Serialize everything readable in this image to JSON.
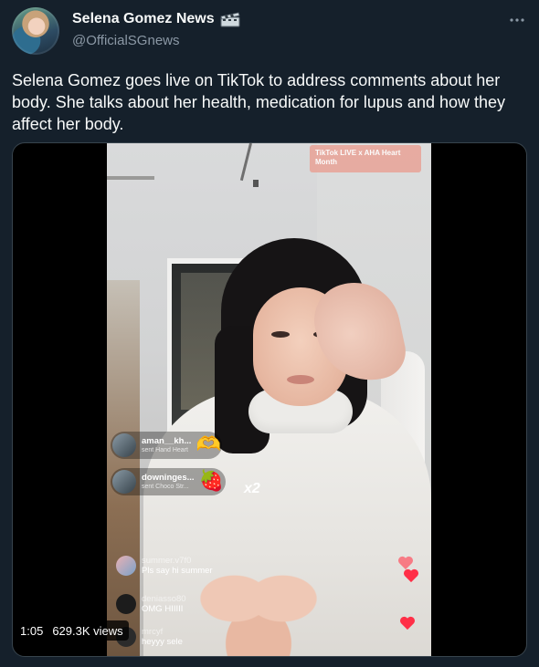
{
  "tweet": {
    "display_name": "Selena Gomez News",
    "name_emoji_icon": "clapper-board-icon",
    "handle": "@OfficialSGnews",
    "text": "Selena Gomez goes live on TikTok to address comments about her body. She talks about her health, medication for lupus and how they affect her body.",
    "more_icon": "more-icon"
  },
  "media": {
    "banner": "TikTok LIVE x AHA Heart Month",
    "gifts": [
      {
        "user": "aman__kh...",
        "sent": "sent Hand Heart",
        "emoji": "🫶"
      },
      {
        "user": "downinges...",
        "sent": "sent Choco Str...",
        "emoji": "🍓"
      }
    ],
    "multiplier": "x2",
    "comments": [
      {
        "user": "summer.v7f0",
        "text": "Pls say hi summer"
      },
      {
        "user": "deniasso80",
        "text": "OMG HIIIII"
      },
      {
        "user": "mrcyf",
        "text": "heyyy sele"
      }
    ],
    "duration": "1:05",
    "views": "629.3K views"
  },
  "colors": {
    "background": "#15202b",
    "text": "#f7f9f9",
    "secondary_text": "#8b98a5",
    "border": "#38444d"
  }
}
